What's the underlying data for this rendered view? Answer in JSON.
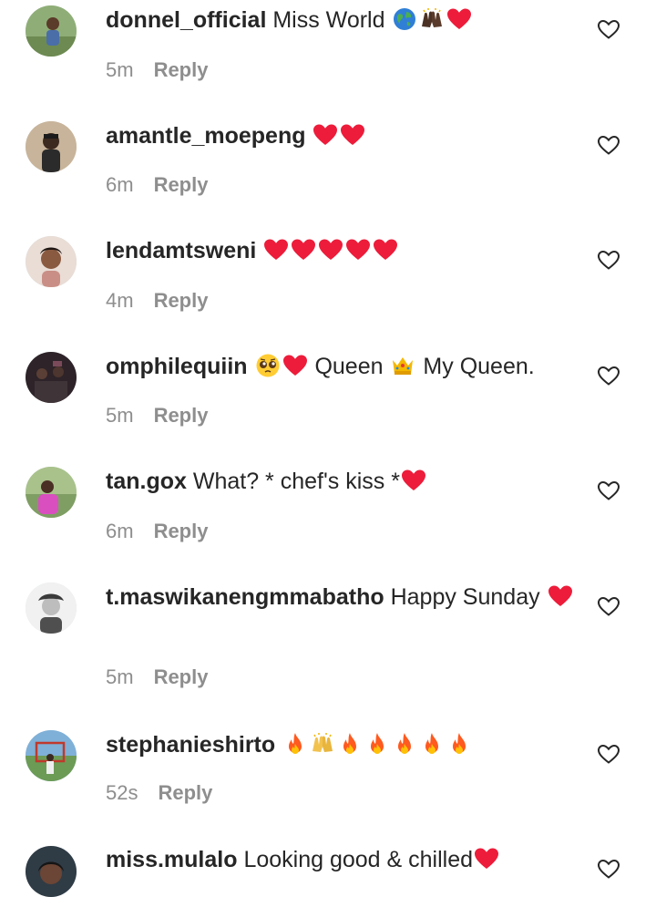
{
  "comments": [
    {
      "username": "donnel_official",
      "text": "Miss World",
      "emojis": [
        "globe-emoji",
        "raised-hands-emoji",
        "red-heart-emoji"
      ],
      "time": "5m",
      "reply": "Reply",
      "avatar_color": "#7aa06b"
    },
    {
      "username": "amantle_moepeng",
      "text": "",
      "emojis": [
        "red-heart-emoji",
        "red-heart-emoji"
      ],
      "time": "6m",
      "reply": "Reply",
      "avatar_color": "#b08d6e"
    },
    {
      "username": "lendamtsweni",
      "text": "",
      "emojis": [
        "red-heart-emoji",
        "red-heart-emoji",
        "red-heart-emoji",
        "red-heart-emoji",
        "red-heart-emoji"
      ],
      "time": "4m",
      "reply": "Reply",
      "avatar_color": "#d9c6bd"
    },
    {
      "username": "omphilequiin",
      "text": "",
      "emojis": [
        "pleading-face-emoji",
        "red-heart-emoji"
      ],
      "text_after": "Queen",
      "emojis_after": [
        "crown-emoji"
      ],
      "text_end": "My Queen.",
      "time": "5m",
      "reply": "Reply",
      "avatar_color": "#3b2f32"
    },
    {
      "username": "tan.gox",
      "text": "What? * chef's kiss *",
      "emojis": [
        "red-heart-emoji"
      ],
      "time": "6m",
      "reply": "Reply",
      "avatar_color": "#9bb47e"
    },
    {
      "username": "t.maswikanengmmabatho",
      "text": "Happy Sunday",
      "emojis": [
        "red-heart-emoji"
      ],
      "time": "5m",
      "reply": "Reply",
      "avatar_color": "#e0e0e0"
    },
    {
      "username": "stephanieshirto",
      "text": "",
      "emojis": [
        "fire-emoji",
        "raised-hands-emoji",
        "fire-emoji",
        "fire-emoji",
        "fire-emoji",
        "fire-emoji",
        "fire-emoji"
      ],
      "time": "52s",
      "reply": "Reply",
      "avatar_color": "#6f9f62"
    },
    {
      "username": "miss.mulalo",
      "text": "Looking good & chilled",
      "emojis": [
        "red-heart-emoji"
      ],
      "time": "",
      "reply": "",
      "avatar_color": "#2f3b45"
    }
  ],
  "colors": {
    "text": "#262626",
    "meta": "#8e8e8e",
    "heart": "#ed1c3a",
    "like_outline": "#262626"
  }
}
